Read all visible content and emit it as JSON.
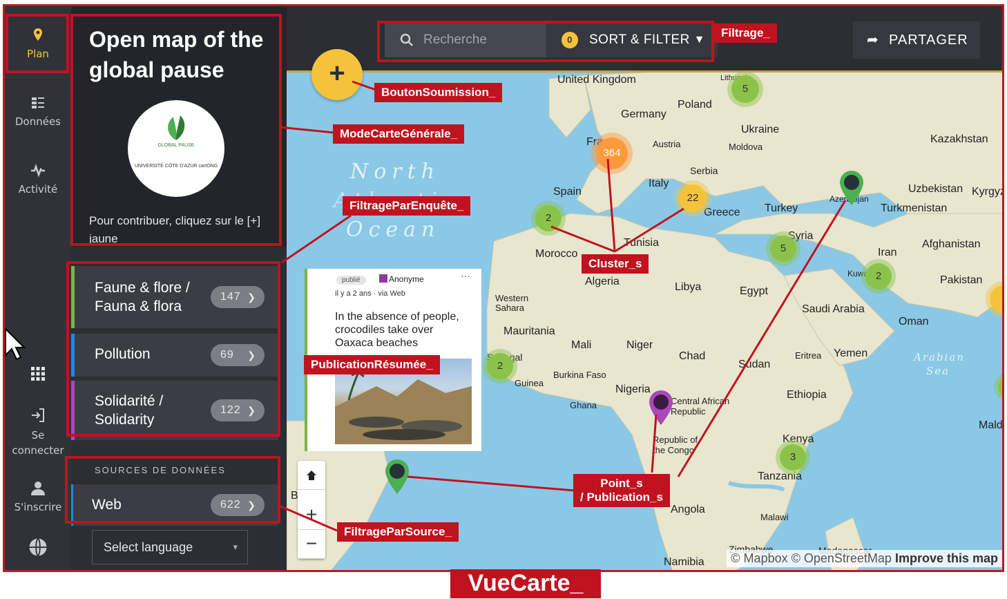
{
  "rail": {
    "items": [
      {
        "label": "Plan",
        "icon": "map-pin-icon"
      },
      {
        "label": "Données",
        "icon": "list-icon"
      },
      {
        "label": "Activité",
        "icon": "activity-icon"
      },
      {
        "label": "Se connecter",
        "icon": "login-icon"
      },
      {
        "label": "S'inscrire",
        "icon": "user-icon"
      }
    ],
    "accent": "#f5c33b"
  },
  "panel": {
    "title": "Open map of the global pause",
    "logo_text": "GLOBAL PAUSE",
    "logo_sub": "UNIVERSITÉ CÔTE D'AZUR  cartONG",
    "contribute_text": "Pour contribuer, cliquez sur le [+] jaune",
    "surveys": [
      {
        "label": "Faune & flore / Fauna & flora",
        "count": "147",
        "color": "#7cb342"
      },
      {
        "label": "Pollution",
        "count": "69",
        "color": "#1e88e5"
      },
      {
        "label": "Solidarité / Solidarity",
        "count": "122",
        "color": "#ab47bc"
      }
    ],
    "sources_heading": "SOURCES DE DONNÉES",
    "sources": [
      {
        "label": "Web",
        "count": "622",
        "color": "#1e88e5"
      }
    ],
    "language_select": "Select language"
  },
  "topbar": {
    "search_placeholder": "Recherche",
    "sort_count": "0",
    "sort_label": "SORT & FILTER",
    "share_label": "PARTAGER",
    "add_label": "+"
  },
  "map": {
    "places": [
      "United Kingdom",
      "Poland",
      "Germany",
      "Ukraine",
      "Kazakhstan",
      "France",
      "Austria",
      "Moldova",
      "Serbia",
      "Italy",
      "Spain",
      "Greece",
      "Turkey",
      "Azerbaijan",
      "Uzbekistan",
      "Kyrgyz",
      "Turkmenistan",
      "Tunisia",
      "Syria",
      "Morocco",
      "Algeria",
      "Libya",
      "Egypt",
      "Iran",
      "Afghanistan",
      "Kuwait",
      "Pakistan",
      "Western Sahara",
      "Saudi Arabia",
      "Oman",
      "Mauritania",
      "Mali",
      "Niger",
      "Chad",
      "Sudan",
      "Eritrea",
      "Yemen",
      "Senegal",
      "Guinea",
      "Burkina Faso",
      "Nigeria",
      "Ghana",
      "Central African Republic",
      "Ethiopia",
      "Maldiv",
      "Republic of the Congo",
      "Kenya",
      "Tanzania",
      "Brazil",
      "Angola",
      "Malawi",
      "Zimbabwe",
      "Madagascar",
      "Namibia",
      "Lithuania"
    ],
    "ocean_labels": [
      "North",
      "Atlantic",
      "Ocean",
      "Arabian Sea"
    ],
    "clusters": [
      "5",
      "364",
      "22",
      "2",
      "5",
      "2",
      "2",
      "3"
    ],
    "attribution": "© Mapbox © OpenStreetMap",
    "attribution_link": "Improve this map"
  },
  "publication": {
    "status": "publié",
    "author": "Anonyme",
    "meta": "il y a 2 ans · via Web",
    "title": "In the absence of people, crocodiles take over Oaxaca beaches",
    "more": "···"
  },
  "annotations": {
    "filtrage": "Filtrage_",
    "bouton": "BoutonSoumission_",
    "mode": "ModeCarteGénérale_",
    "enquete": "FiltrageParEnquête_",
    "cluster": "Cluster_s",
    "publication": "PublicationRésumée_",
    "point": "Point_s",
    "point2": "/ Publication_s",
    "source": "FiltrageParSource_",
    "vue": "VueCarte_"
  }
}
